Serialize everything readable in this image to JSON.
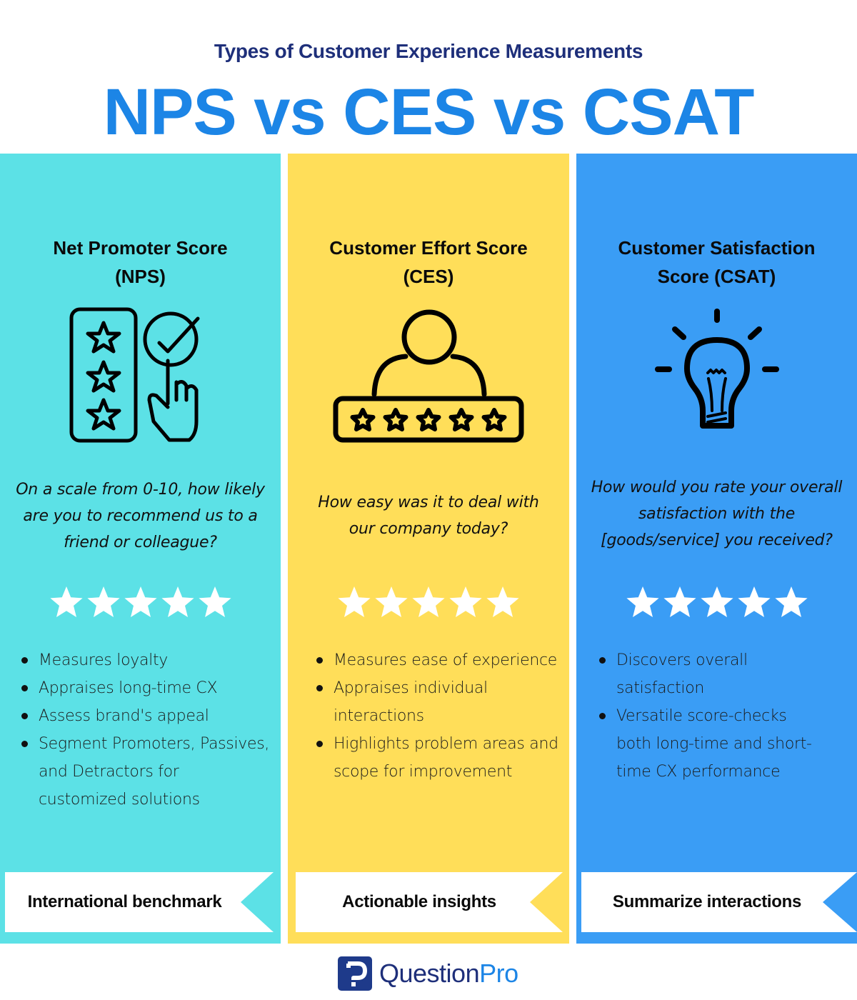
{
  "header": {
    "subtitle": "Types of Customer Experience Measurements",
    "title": "NPS vs CES vs CSAT"
  },
  "colors": {
    "nps": "#5ce1e6",
    "ces": "#ffde59",
    "csat": "#3a9df5",
    "title_blue": "#1c85e6",
    "subtitle_navy": "#1e2f7a",
    "ribbon_fill": "#ffffff",
    "star_fill": "#ffffff",
    "icon_stroke": "#000000"
  },
  "columns": [
    {
      "id": "nps",
      "title": "Net Promoter Score (NPS)",
      "icon": "rating-card-hand-check-icon",
      "question": "On a scale from 0-10, how likely are you to recommend us to a friend or colleague?",
      "rating_stars": 5,
      "bullets": [
        "Measures loyalty",
        "Appraises long-time CX",
        "Assess brand's appeal",
        "Segment Promoters, Passives, and Detractors for customized solutions"
      ],
      "ribbon": "International benchmark"
    },
    {
      "id": "ces",
      "title": "Customer Effort Score (CES)",
      "icon": "user-rating-bar-icon",
      "question": "How easy was it to deal with our company today?",
      "rating_stars": 5,
      "bullets": [
        "Measures ease of experience",
        "Appraises individual interactions",
        "Highlights problem areas and scope for improvement"
      ],
      "ribbon": "Actionable insights"
    },
    {
      "id": "csat",
      "title": "Customer Satisfaction Score (CSAT)",
      "icon": "lightbulb-icon",
      "question": "How would you rate your overall satisfaction with the [goods/service] you received?",
      "rating_stars": 5,
      "bullets": [
        "Discovers overall satisfaction",
        "Versatile score-checks both long-time and short-time CX performance"
      ],
      "ribbon": "Summarize interactions"
    }
  ],
  "footer": {
    "brand_part1": "Question",
    "brand_part2": "Pro"
  }
}
